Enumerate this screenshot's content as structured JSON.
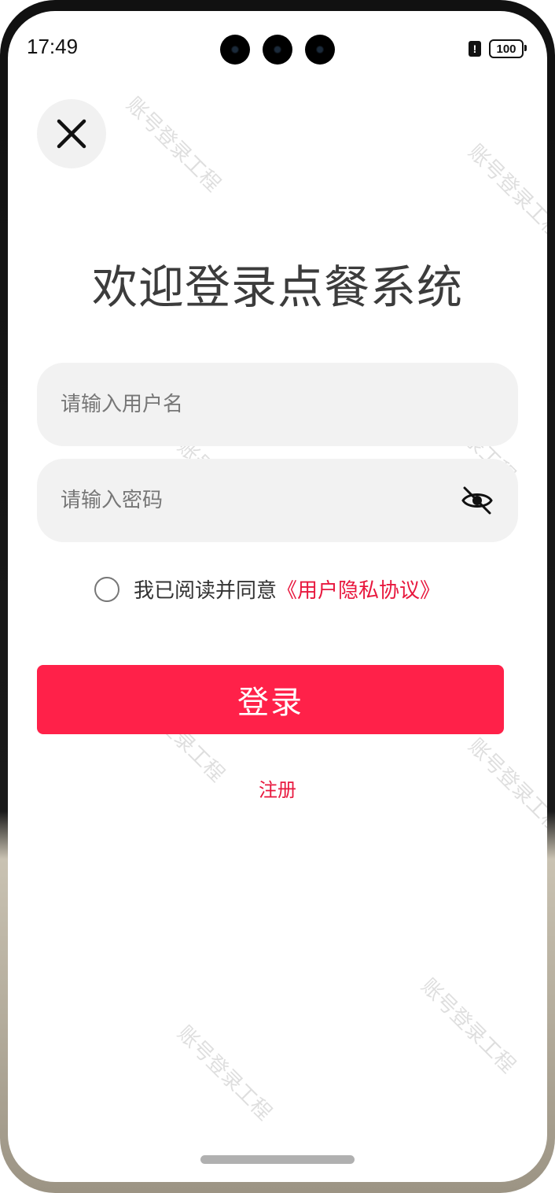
{
  "status_bar": {
    "time": "17:49",
    "alert_icon": "exclamation-icon",
    "alert_glyph": "!",
    "battery": "100"
  },
  "header": {
    "close_icon": "close-icon"
  },
  "title": "欢迎登录点餐系统",
  "form": {
    "username_placeholder": "请输入用户名",
    "username_value": "",
    "password_placeholder": "请输入密码",
    "password_value": "",
    "password_toggle_icon": "eye-off-icon"
  },
  "agreement": {
    "checked": false,
    "text": "我已阅读并同意",
    "link": "《用户隐私协议》"
  },
  "login_label": "登录",
  "register_label": "注册",
  "watermark_text": "账号登录工程",
  "colors": {
    "accent": "#ff2149",
    "link": "#e8183e",
    "field_bg": "#f2f2f2",
    "title": "#3c3c3c"
  }
}
